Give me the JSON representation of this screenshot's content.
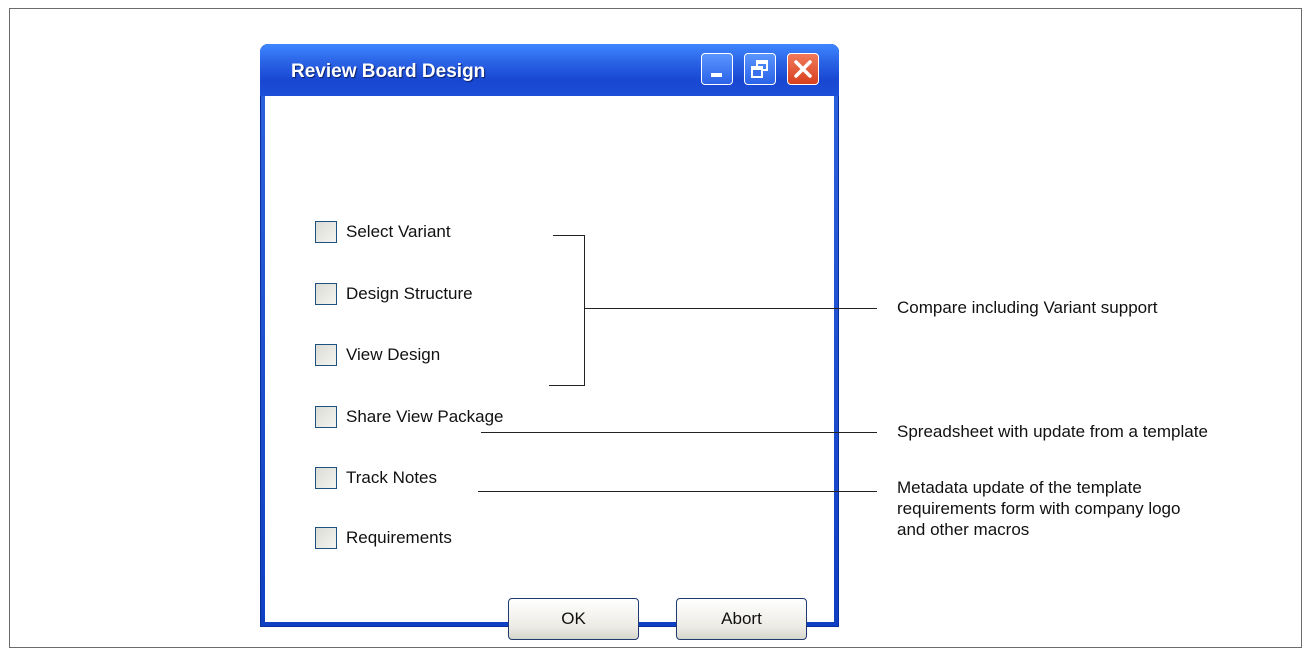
{
  "window": {
    "title": "Review Board Design",
    "controls": {
      "minimize": "minimize-icon",
      "restore": "restore-icon",
      "close": "close-icon"
    }
  },
  "options": [
    {
      "label": "Select Variant",
      "checked": false
    },
    {
      "label": "Design Structure",
      "checked": false
    },
    {
      "label": "View Design",
      "checked": false
    },
    {
      "label": "Share View Package",
      "checked": false
    },
    {
      "label": "Track Notes",
      "checked": false
    },
    {
      "label": "Requirements",
      "checked": false
    }
  ],
  "buttons": {
    "ok": "OK",
    "abort": "Abort"
  },
  "annotations": {
    "compare": "Compare including Variant support",
    "spreadsheet": "Spreadsheet with update from a template",
    "metadata": [
      "Metadata update of the template",
      "requirements form with company logo",
      "and other macros"
    ]
  },
  "colors": {
    "titlebar": "#2a63e6",
    "close_button": "#d8401f",
    "checkbox_border": "#1c5180"
  }
}
